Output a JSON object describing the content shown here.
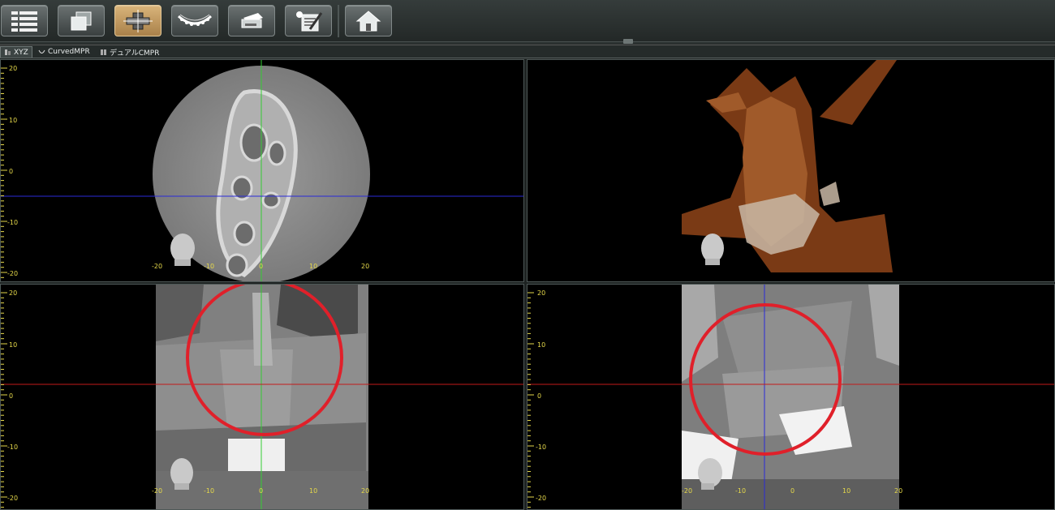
{
  "toolbar": {
    "buttons": [
      {
        "name": "list-view-button",
        "icon": "list-icon"
      },
      {
        "name": "layers-button",
        "icon": "layers-icon"
      },
      {
        "name": "mpr-view-button",
        "icon": "mpr-cross-icon",
        "active": true
      },
      {
        "name": "panoramic-button",
        "icon": "dental-arch-icon"
      },
      {
        "name": "print-button",
        "icon": "printer-icon"
      },
      {
        "name": "report-button",
        "icon": "report-edit-icon"
      },
      {
        "name": "home-button",
        "icon": "home-icon"
      }
    ]
  },
  "tabs": [
    {
      "label": "XYZ",
      "active": true
    },
    {
      "label": "CurvedMPR",
      "active": false
    },
    {
      "label": "デュアルCMPR",
      "active": false
    }
  ],
  "rulers": {
    "v_ticks": [
      "20",
      "10",
      "0",
      "-10",
      "-20"
    ],
    "h_ticks": [
      "-20",
      "-10",
      "0",
      "10",
      "20"
    ]
  },
  "colors": {
    "accent_orange": "#d9b47a",
    "ruler_yellow": "#e6d94a",
    "crosshair_green": "#33cc33",
    "crosshair_blue": "#2a2ad8",
    "crosshair_red": "#c21a1a",
    "annotation_red": "#e0202a",
    "bone_render": "#8a4a22"
  }
}
